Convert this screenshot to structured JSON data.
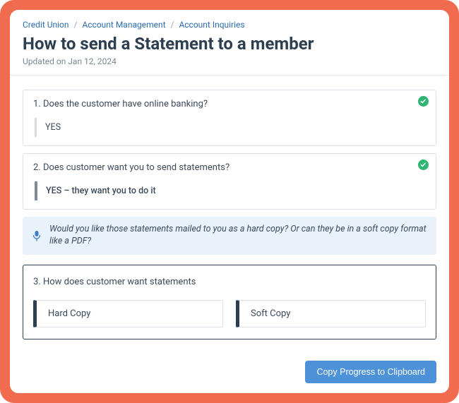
{
  "breadcrumb": {
    "a": "Credit Union",
    "b": "Account Management",
    "c": "Account Inquiries"
  },
  "title": "How to send a Statement to a member",
  "updated": "Updated on Jan 12, 2024",
  "steps": [
    {
      "q": "1. Does the customer have online banking?",
      "ans": "YES"
    },
    {
      "q": "2. Does customer want you to send statements?",
      "ans": "YES – they want you to do it"
    },
    {
      "q": "3. How does customer want statements"
    }
  ],
  "prompt": "Would you like those statements mailed to you as a hard copy? Or can they be in a soft copy format like a PDF?",
  "options": {
    "a": "Hard Copy",
    "b": "Soft Copy"
  },
  "copy_btn": "Copy Progress to Clipboard"
}
